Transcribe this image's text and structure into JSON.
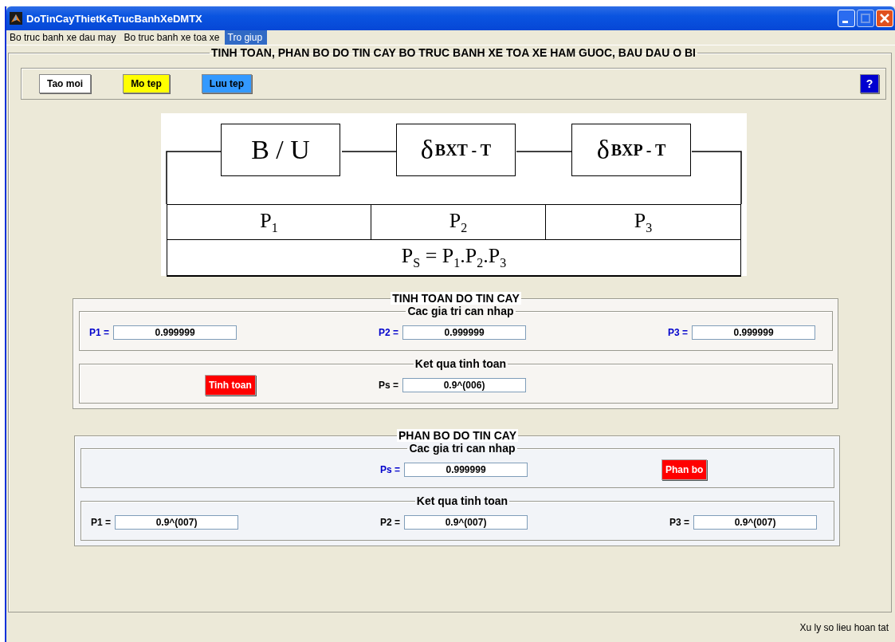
{
  "window": {
    "title": "DoTinCayThietKeTrucBanhXeDMTX"
  },
  "menu": [
    {
      "label": "Bo truc banh xe dau may",
      "selected": false
    },
    {
      "label": "Bo truc banh xe toa xe",
      "selected": false
    },
    {
      "label": "Tro giup",
      "selected": true
    }
  ],
  "main": {
    "title": "TINH TOAN, PHAN BO DO TIN CAY BO TRUC BANH XE TOA XE HAM GUOC, BAU DAU O BI",
    "toolbar": [
      {
        "label": "Tao moi",
        "color": "#ffffff"
      },
      {
        "label": "Mo tep",
        "color": "#ffff00"
      },
      {
        "label": "Luu tep",
        "color": "#3399ff"
      }
    ],
    "help_button": "?"
  },
  "diagram": {
    "blocks": [
      {
        "symbol": "B / U"
      },
      {
        "symbol": "δ",
        "subscript": "BXT - T"
      },
      {
        "symbol": "δ",
        "subscript": "BXP - T"
      }
    ],
    "probabilities": [
      "P$_{1}$",
      "P$_{2}$",
      "P$_{3}$"
    ],
    "formula": "P$_{S}$ = P$_{1}$.P$_{2}$.P$_{3}$"
  },
  "sections": [
    {
      "title": "TINH TOAN DO TIN CAY",
      "groups": [
        {
          "title": "Cac gia tri can nhap",
          "kind": "input",
          "items": [
            {
              "kind": "field",
              "label": "P1 =",
              "value": "0.999999"
            },
            {
              "kind": "field",
              "label": "P2 =",
              "value": "0.999999"
            },
            {
              "kind": "field",
              "label": "P3 =",
              "value": "0.999999"
            }
          ]
        },
        {
          "title": "Ket qua tinh toan",
          "kind": "result",
          "items": [
            {
              "kind": "button",
              "label": "Tinh toan"
            },
            {
              "kind": "field",
              "label": "Ps =",
              "value": "0.9^(006)"
            }
          ]
        }
      ]
    },
    {
      "title": "PHAN BO DO TIN CAY",
      "groups": [
        {
          "title": "Cac gia tri can nhap",
          "kind": "input",
          "items": [
            {
              "kind": "field",
              "label": "Ps =",
              "value": "0.999999"
            },
            {
              "kind": "button",
              "label": "Phan bo"
            }
          ]
        },
        {
          "title": "Ket qua tinh toan",
          "kind": "result",
          "items": [
            {
              "kind": "field",
              "label": "P1 =",
              "value": "0.9^(007)"
            },
            {
              "kind": "field",
              "label": "P2 =",
              "value": "0.9^(007)"
            },
            {
              "kind": "field",
              "label": "P3 =",
              "value": "0.9^(007)"
            }
          ]
        }
      ]
    }
  ],
  "status_bar": "Xu ly so lieu hoan tat"
}
